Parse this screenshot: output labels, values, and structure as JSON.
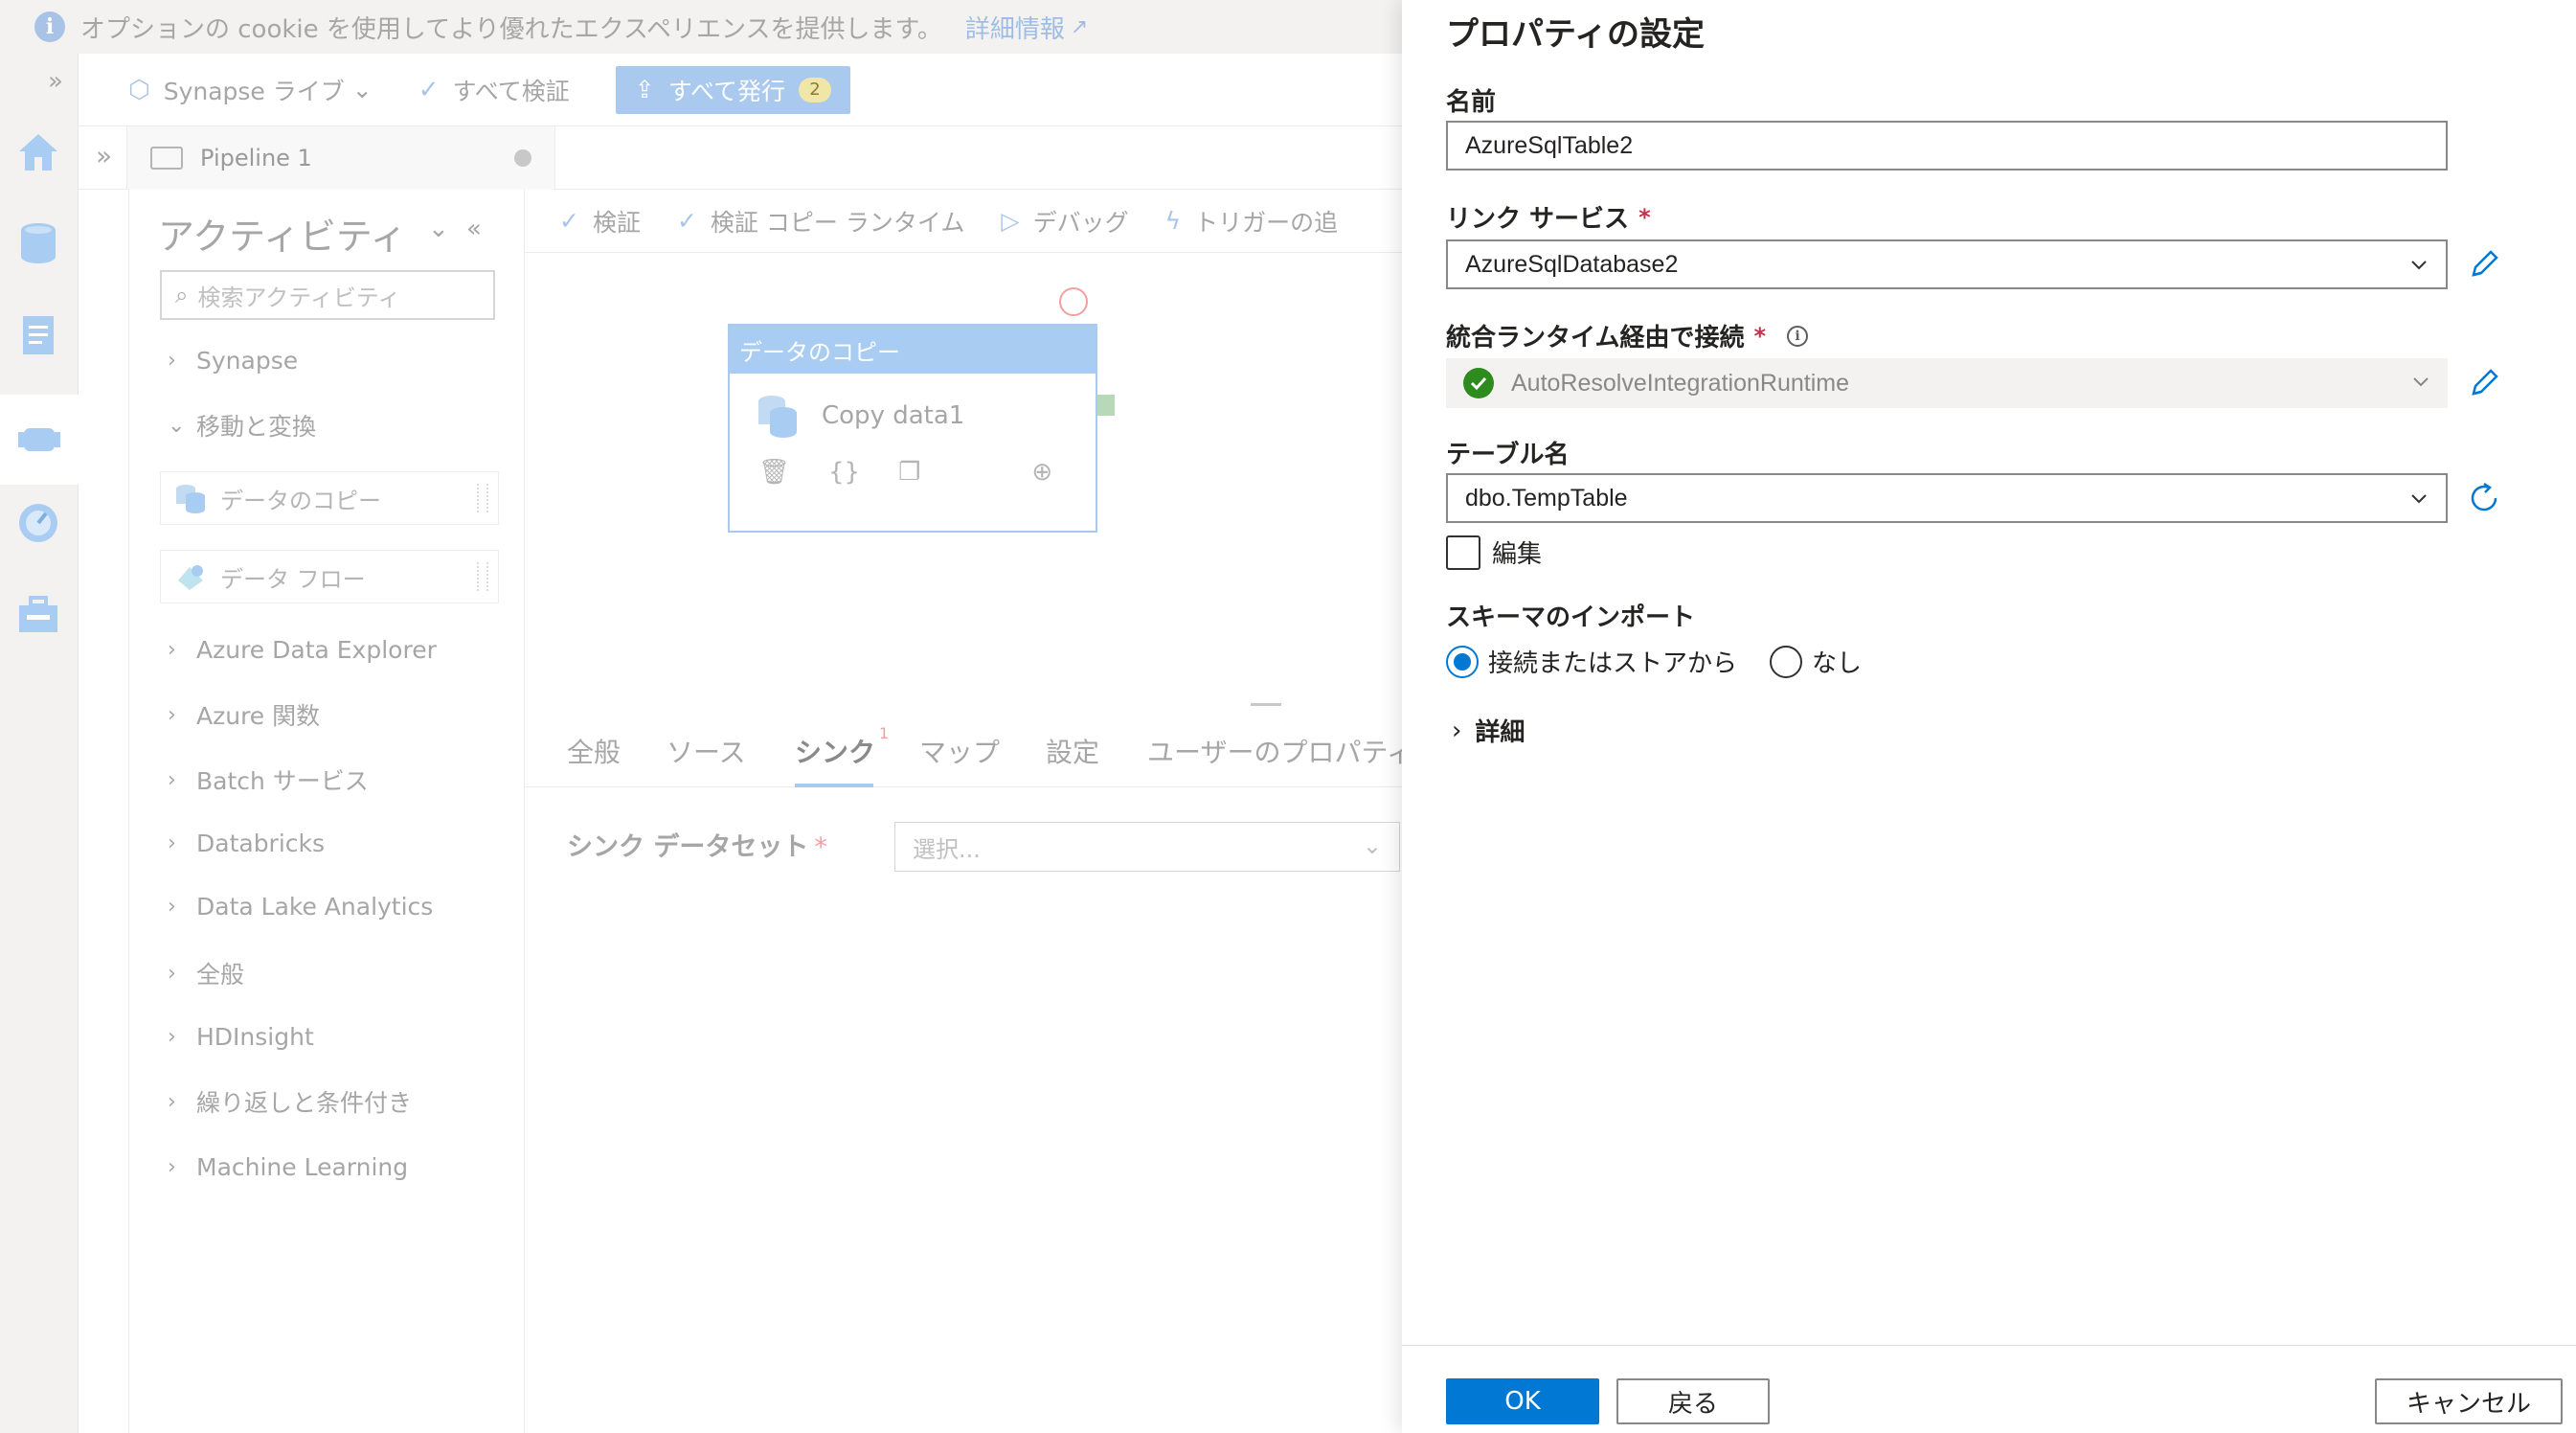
{
  "cookie_bar": {
    "message": "オプションの cookie を使用してより優れたエクスペリエンスを提供します。",
    "link": "詳細情報"
  },
  "topbar": {
    "synapse_live": "Synapse ライブ",
    "validate_all": "すべて検証",
    "publish_all": "すべて発行",
    "publish_count": "2"
  },
  "tab": {
    "pipeline_name": "Pipeline 1"
  },
  "activities": {
    "title": "アクティビティ",
    "search_placeholder": "検索アクティビティ",
    "categories": [
      "Synapse",
      "移動と変換",
      "Azure Data Explorer",
      "Azure 関数",
      "Batch サービス",
      "Databricks",
      "Data Lake Analytics",
      "全般",
      "HDInsight",
      "繰り返しと条件付き",
      "Machine Learning"
    ],
    "items": [
      "データのコピー",
      "データ フロー"
    ]
  },
  "canvas_toolbar": {
    "validate": "検証",
    "validate_copy_runtime": "検証 コピー ランタイム",
    "debug": "デバッグ",
    "add_trigger": "トリガーの追"
  },
  "node": {
    "header": "データのコピー",
    "name": "Copy data1",
    "actions": {
      "code": "{}"
    }
  },
  "props_tabs": {
    "tabs": [
      "全般",
      "ソース",
      "シンク",
      "マップ",
      "設定",
      "ユーザーのプロパティ"
    ],
    "sink_badge": "1",
    "sink_dataset_label": "シンク データセット",
    "sink_dataset_req": "*",
    "sink_dataset_placeholder": "選択..."
  },
  "panel": {
    "title": "プロパティの設定",
    "name_label": "名前",
    "name_value": "AzureSqlTable2",
    "linked_service_label": "リンク サービス",
    "linked_service_value": "AzureSqlDatabase2",
    "runtime_label": "統合ランタイム経由で接続",
    "runtime_value": "AutoResolveIntegrationRuntime",
    "table_label": "テーブル名",
    "table_value": "dbo.TempTable",
    "edit_label": "編集",
    "import_schema_label": "スキーマのインポート",
    "import_option_1": "接続またはストアから",
    "import_option_2": "なし",
    "advanced_label": "詳細",
    "required_mark": "*",
    "ok": "OK",
    "back": "戻る",
    "cancel": "キャンセル"
  },
  "colors": {
    "primary": "#0078d4",
    "required": "#c4314b",
    "success": "#2e8b1e"
  }
}
